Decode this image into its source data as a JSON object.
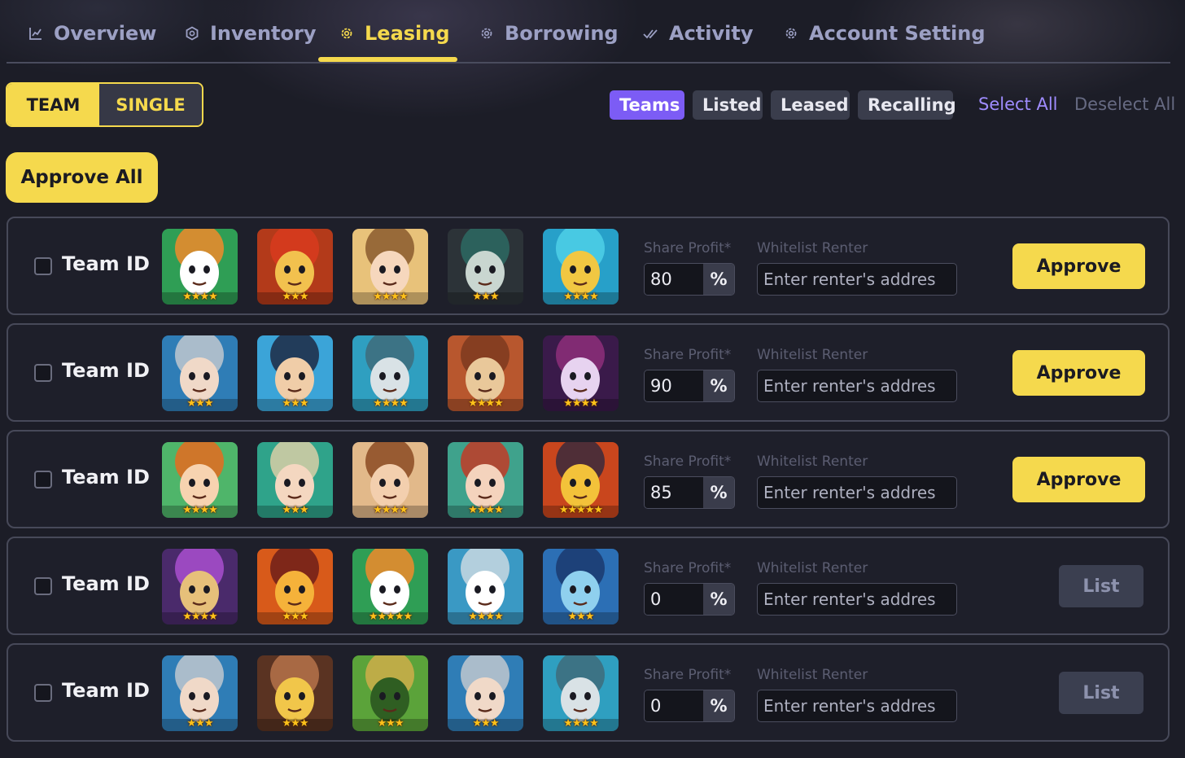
{
  "nav": {
    "tabs": [
      {
        "label": "Overview",
        "icon": "chart-line-icon"
      },
      {
        "label": "Inventory",
        "icon": "hexagon-icon"
      },
      {
        "label": "Leasing",
        "icon": "gear-icon",
        "active": true
      },
      {
        "label": "Borrowing",
        "icon": "gear-icon"
      },
      {
        "label": "Activity",
        "icon": "double-check-icon"
      },
      {
        "label": "Account Setting",
        "icon": "gear-icon"
      }
    ]
  },
  "mode_toggle": {
    "team": "TEAM",
    "single": "SINGLE",
    "selected": "TEAM"
  },
  "filters": {
    "items": [
      "Teams",
      "Listed",
      "Leased",
      "Recalling"
    ],
    "active": "Teams",
    "select_all": "Select All",
    "deselect_all": "Deselect All"
  },
  "approve_all": "Approve All",
  "fields": {
    "share_profit_label": "Share Profit*",
    "whitelist_label": "Whitelist Renter",
    "whitelist_placeholder": "Enter renter's addres",
    "percent_symbol": "%"
  },
  "colors": {
    "accent": "#f5d94d",
    "filter_active": "#7c5cf5",
    "background": "#1c1d27"
  },
  "rows": [
    {
      "label": "Team ID",
      "checked": false,
      "share_profit": "80",
      "action": "Approve",
      "heroes": [
        {
          "name": "tiger-warrior",
          "stars": 4
        },
        {
          "name": "red-demon",
          "stars": 3
        },
        {
          "name": "brown-haired-girl",
          "stars": 4
        },
        {
          "name": "bearded-sage",
          "stars": 3
        },
        {
          "name": "blue-helmet-priestess",
          "stars": 4
        }
      ]
    },
    {
      "label": "Team ID",
      "checked": false,
      "share_profit": "90",
      "action": "Approve",
      "heroes": [
        {
          "name": "armored-knight",
          "stars": 3
        },
        {
          "name": "pirate-captain",
          "stars": 3
        },
        {
          "name": "crocodile-pharaoh",
          "stars": 4
        },
        {
          "name": "horned-minotaur",
          "stars": 4
        },
        {
          "name": "purple-witch",
          "stars": 4
        }
      ]
    },
    {
      "label": "Team ID",
      "checked": false,
      "share_profit": "85",
      "action": "Approve",
      "heroes": [
        {
          "name": "orange-haired-ranger",
          "stars": 4
        },
        {
          "name": "goggle-engineer",
          "stars": 3
        },
        {
          "name": "brown-haired-hero",
          "stars": 4
        },
        {
          "name": "elf-girl",
          "stars": 4
        },
        {
          "name": "dark-dragon-lord",
          "stars": 5
        }
      ]
    },
    {
      "label": "Team ID",
      "checked": false,
      "share_profit": "0",
      "action": "List",
      "heroes": [
        {
          "name": "purple-mage",
          "stars": 4
        },
        {
          "name": "fire-ninja",
          "stars": 3
        },
        {
          "name": "tiger-warrior",
          "stars": 5
        },
        {
          "name": "frost-beast",
          "stars": 4
        },
        {
          "name": "hooded-shark",
          "stars": 3
        }
      ]
    },
    {
      "label": "Team ID",
      "checked": false,
      "share_profit": "0",
      "action": "List",
      "heroes": [
        {
          "name": "armored-knight",
          "stars": 3
        },
        {
          "name": "horned-sorceress",
          "stars": 3
        },
        {
          "name": "leaf-golem",
          "stars": 3
        },
        {
          "name": "armored-knight",
          "stars": 3
        },
        {
          "name": "crocodile-pharaoh",
          "stars": 4
        }
      ]
    }
  ]
}
